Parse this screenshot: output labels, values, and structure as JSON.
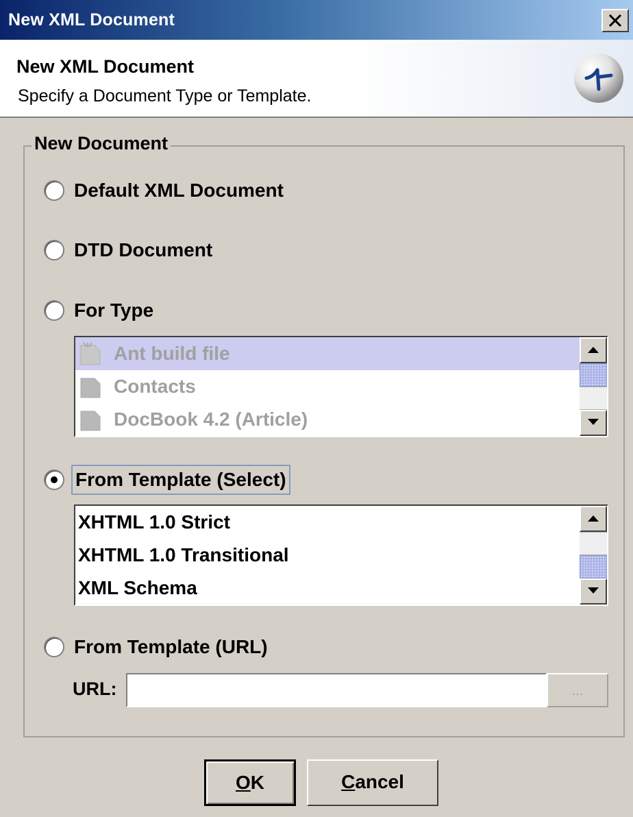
{
  "window": {
    "title": "New XML Document"
  },
  "header": {
    "title": "New XML Document",
    "subtitle": "Specify a Document Type or Template."
  },
  "group": {
    "legend": "New Document",
    "options": {
      "default_xml": "Default XML Document",
      "dtd": "DTD Document",
      "for_type": "For Type",
      "from_template_select": "From Template (Select)",
      "from_template_url": "From Template (URL)"
    },
    "selected_option": "From Template (Select)",
    "type_list": {
      "items": [
        "Ant build file",
        "Contacts",
        "DocBook 4.2 (Article)"
      ],
      "enabled": false,
      "highlighted_item": "Ant build file"
    },
    "template_list": {
      "items": [
        "XHTML 1.0 Strict",
        "XHTML 1.0 Transitional",
        "XML Schema"
      ]
    },
    "url": {
      "label": "URL:",
      "value": "",
      "browse_label": "..."
    }
  },
  "buttons": {
    "ok_mnemonic": "O",
    "ok_rest": "K",
    "cancel_mnemonic": "C",
    "cancel_rest": "ancel"
  },
  "colors": {
    "titlebar_start": "#0a246a",
    "titlebar_end": "#a6caf0",
    "dialog_bg": "#d4d0c8",
    "list_highlight_disabled": "#ccccf0",
    "scroll_thumb": "#aab4e8"
  },
  "icons": {
    "close": "close-icon",
    "banner": "compass-logo-icon",
    "list_item": "document-icon",
    "scroll_up": "arrow-up-icon",
    "scroll_down": "arrow-down-icon"
  }
}
